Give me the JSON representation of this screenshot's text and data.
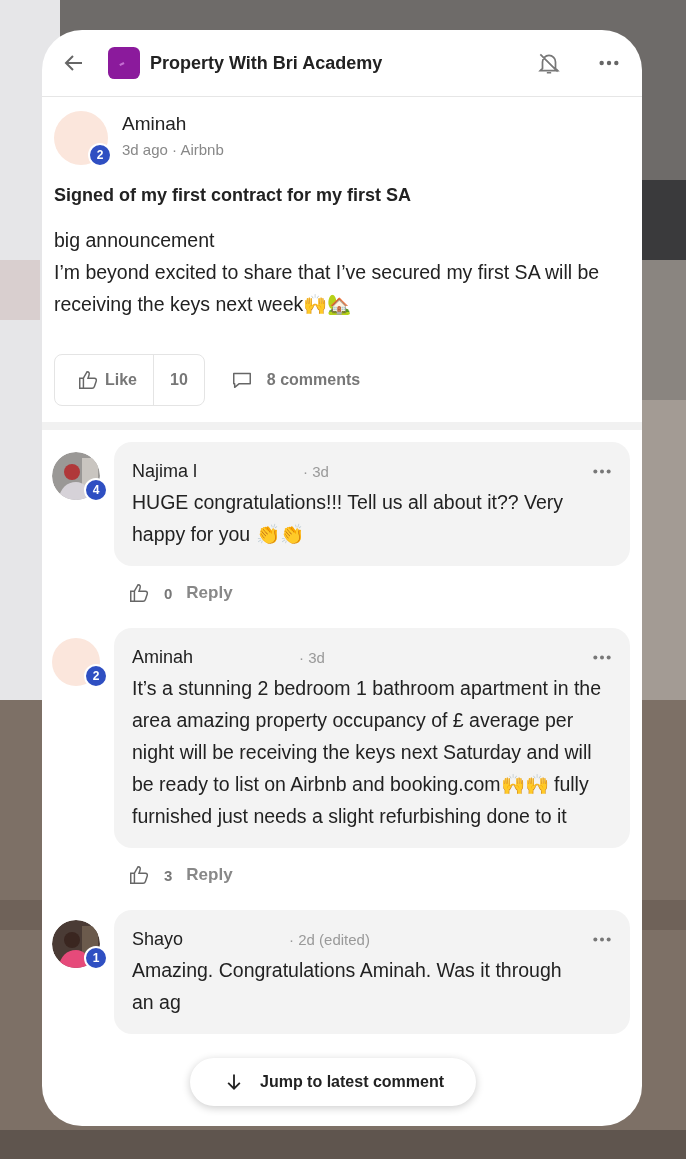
{
  "header": {
    "title": "Property With Bri Academy"
  },
  "post": {
    "author": "Aminah",
    "level": "2",
    "meta": "3d ago · Airbnb",
    "title": "Signed of my first contract for my first SA",
    "body": [
      "big announcement",
      "I’m beyond excited to share that I’ve secured my first SA will be receiving the keys next week🙌🏡"
    ],
    "like_label": "Like",
    "like_count": "10",
    "comments_label": "8 comments"
  },
  "comments": [
    {
      "author": "Najima l",
      "level": "4",
      "time": "· 3d",
      "text": "HUGE congratulations!!! Tell us all about it?? Very happy for you 👏👏",
      "likes": "0",
      "reply": "Reply"
    },
    {
      "author": "Aminah",
      "level": "2",
      "kind": "blank",
      "time": "· 3d",
      "text": "It’s a stunning 2 bedroom 1 bathroom apartment in the area amazing property occupancy of £ average per night will be receiving the keys next Saturday and will be ready to list on Airbnb and booking.com🙌🙌 fully furnished just needs a slight refurbishing done to it",
      "likes": "3",
      "reply": "Reply"
    },
    {
      "author": "Shayo",
      "level": "1",
      "time": "· 2d (edited)",
      "text": "Amazing. Congratulations Aminah. Was it through",
      "text_2": "an ag"
    }
  ],
  "jump_button": "Jump to latest comment"
}
